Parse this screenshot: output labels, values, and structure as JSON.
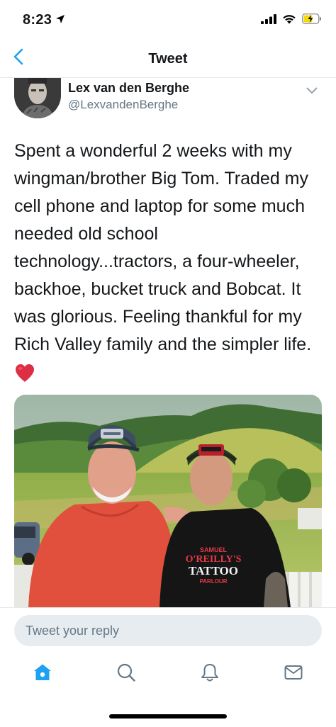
{
  "status_bar": {
    "time": "8:23",
    "icons": [
      "location-arrow-icon",
      "signal-icon",
      "wifi-icon",
      "battery-charging-icon"
    ]
  },
  "nav": {
    "title": "Tweet",
    "back_icon": "chevron-left-icon"
  },
  "tweet": {
    "display_name": "Lex van den Berghe",
    "handle": "@LexvandenBerghe",
    "text": "Spent a wonderful 2 weeks with my wingman/brother Big Tom. Traded my cell phone and laptop for some much needed old school technology...tractors, a four-wheeler, backhoe, bucket truck and Bobcat. It was glorious. Feeling thankful for my Rich Valley family and the simpler life.",
    "emoji": "heart-emoji",
    "photo_shirt_text": [
      "SAMUEL",
      "O'REILLY'S",
      "TATTOO",
      "PARLOUR"
    ]
  },
  "reply": {
    "placeholder": "Tweet your reply"
  },
  "tabs": [
    {
      "icon": "home-icon",
      "active": true
    },
    {
      "icon": "search-icon",
      "active": false
    },
    {
      "icon": "notifications-bell-icon",
      "active": false
    },
    {
      "icon": "messages-envelope-icon",
      "active": false
    }
  ],
  "colors": {
    "accent": "#1da1f2",
    "text": "#14171a",
    "secondary": "#657786",
    "reply_bg": "#e6ecf0",
    "battery_charging": "#f5d90a"
  }
}
